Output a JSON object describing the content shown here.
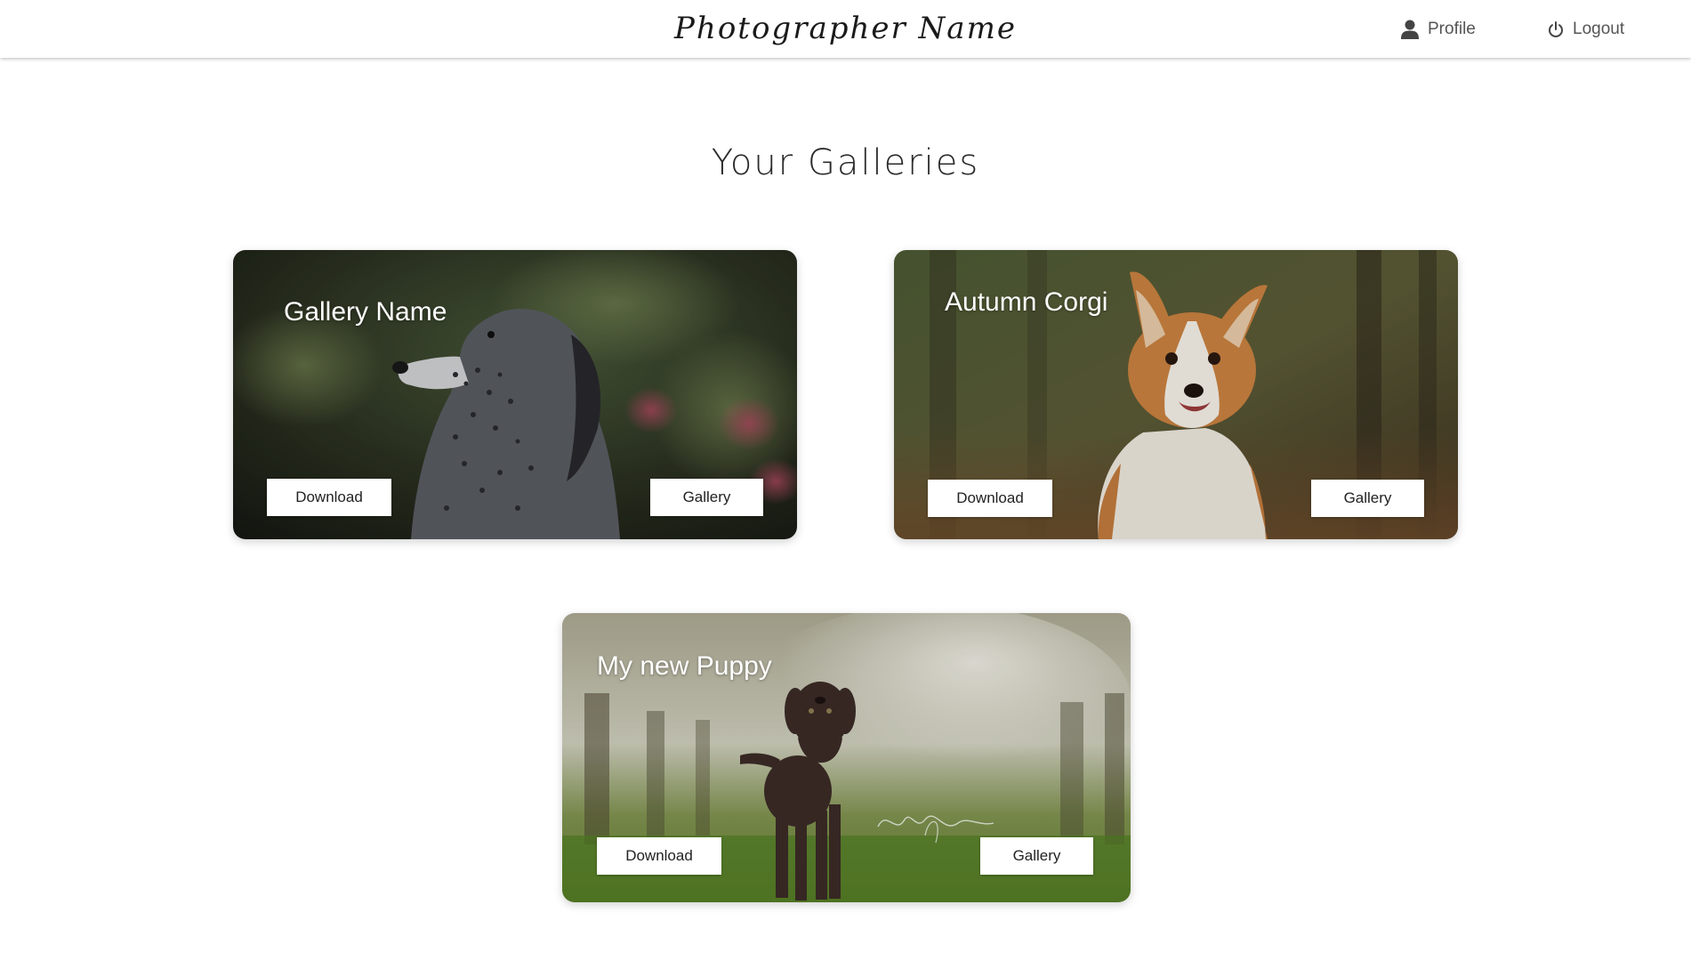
{
  "header": {
    "brand": "Photographer Name",
    "profile_label": "Profile",
    "profile_icon": "person-icon",
    "logout_label": "Logout",
    "logout_icon": "power-icon"
  },
  "page": {
    "title": "Your Galleries"
  },
  "galleries": [
    {
      "name": "Gallery Name",
      "photo": "english-setter-dog-photo",
      "download_label": "Download",
      "gallery_label": "Gallery"
    },
    {
      "name": "Autumn Corgi",
      "photo": "corgi-dog-photo",
      "download_label": "Download",
      "gallery_label": "Gallery"
    },
    {
      "name": "My new Puppy",
      "photo": "labrador-puppy-photo",
      "download_label": "Download",
      "gallery_label": "Gallery"
    }
  ],
  "colors": {
    "header_bg": "#ffffff",
    "nav_text": "#555555",
    "button_bg": "#ffffff",
    "card_title": "#ffffff"
  }
}
